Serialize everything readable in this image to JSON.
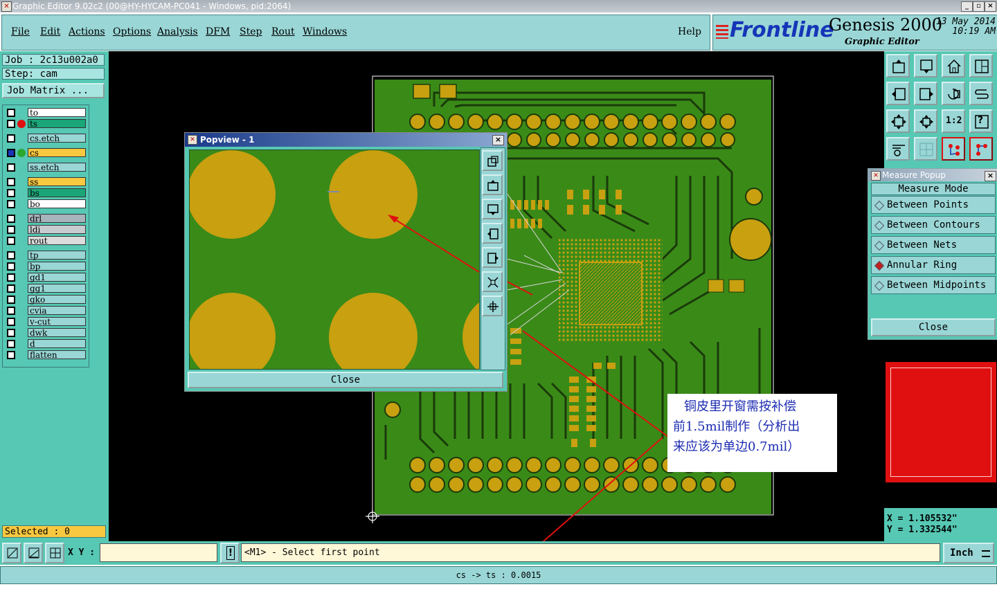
{
  "window": {
    "title": "Graphic Editor 9.02c2 (00@HY-HYCAM-PC041 - Windows, pid:2064)"
  },
  "menu": [
    "File",
    "Edit",
    "Actions",
    "Options",
    "Analysis",
    "DFM",
    "Step",
    "Rout",
    "Windows"
  ],
  "help": "Help",
  "brand": {
    "logo": "Frontline",
    "product": "Genesis 2000",
    "subtitle": "Graphic Editor",
    "date": "13 May 2014",
    "time": "10:19 AM"
  },
  "job": {
    "job_label": "Job : 2c13u002a0",
    "step_label": "Step: cam",
    "matrix_button": "Job Matrix ..."
  },
  "layers": [
    {
      "name": "to",
      "bg": "#ffffff",
      "dot": ""
    },
    {
      "name": "ts",
      "bg": "#1aa678",
      "dot": "#e01010"
    },
    {
      "name": "cs.etch",
      "bg": "#9ad6d6",
      "dot": ""
    },
    {
      "name": "cs",
      "bg": "#f8c840",
      "dot": "#2aa830",
      "active": true
    },
    {
      "name": "ss.etch",
      "bg": "#9ad6d6",
      "dot": ""
    },
    {
      "name": "ss",
      "bg": "#f8c840",
      "dot": ""
    },
    {
      "name": "bs",
      "bg": "#1aa678",
      "dot": ""
    },
    {
      "name": "bo",
      "bg": "#ffffff",
      "dot": ""
    },
    {
      "name": "drl",
      "bg": "#a8b4bc",
      "dot": ""
    },
    {
      "name": "ldi",
      "bg": "#c8ccd0",
      "dot": ""
    },
    {
      "name": "rout",
      "bg": "#dcdcdc",
      "dot": ""
    },
    {
      "name": "tp",
      "bg": "#9ad6d6",
      "dot": ""
    },
    {
      "name": "bp",
      "bg": "#9ad6d6",
      "dot": ""
    },
    {
      "name": "gd1",
      "bg": "#9ad6d6",
      "dot": ""
    },
    {
      "name": "gg1",
      "bg": "#9ad6d6",
      "dot": ""
    },
    {
      "name": "gko",
      "bg": "#9ad6d6",
      "dot": ""
    },
    {
      "name": "cvia",
      "bg": "#9ad6d6",
      "dot": ""
    },
    {
      "name": "v-cut",
      "bg": "#9ad6d6",
      "dot": ""
    },
    {
      "name": "dwk",
      "bg": "#9ad6d6",
      "dot": ""
    },
    {
      "name": "d",
      "bg": "#9ad6d6",
      "dot": ""
    },
    {
      "name": "flatten",
      "bg": "#9ad6d6",
      "dot": ""
    }
  ],
  "selected": "Selected : 0",
  "popview": {
    "title": "Popview - 1",
    "close": "Close"
  },
  "measure": {
    "title": "Measure Popup",
    "mode_label": "Measure Mode",
    "options": [
      "Between Points",
      "Between Contours",
      "Between Nets",
      "Annular Ring",
      "Between Midpoints"
    ],
    "selected": "Annular Ring",
    "close": "Close"
  },
  "coords": {
    "x": "X  =  1.105532\"",
    "y": "Y  =  1.332544\""
  },
  "tools": {
    "zoom_ratio": "1:2",
    "help": "?"
  },
  "bottom": {
    "xy_label": "X Y :",
    "xy_value": "",
    "alert": "!",
    "prompt": "<M1> - Select first point",
    "unit": "Inch"
  },
  "status": "cs -> ts : 0.0015",
  "annotation": {
    "lines": [
      "铜皮里开窗需按补偿",
      "前1.5mil制作（分析出",
      "来应该为单边0.7mil）"
    ]
  },
  "colors": {
    "board": "#3a8a18",
    "pad": "#c8a010",
    "accent": "#e01010"
  }
}
